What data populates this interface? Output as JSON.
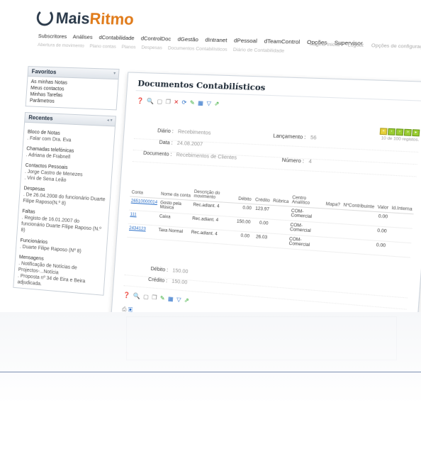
{
  "app": {
    "logo": {
      "prefix": "Mais",
      "accent": "Ritmo"
    },
    "nav": [
      "Subscritores",
      "Análises",
      "dContabilidade",
      "dControlDoc",
      "dGestão",
      "dIntranet",
      "dPessoal",
      "dTeamControl",
      "Opções",
      "Supervisor"
    ],
    "subnav": [
      "Abertura de movimento",
      "Plano contas",
      "Planos",
      "Despesas",
      "Documentos Contabilísticos",
      "Diário de Contabilidade"
    ],
    "top_links": [
      "Página Inicial",
      "Logout",
      "Opções de configuração"
    ]
  },
  "sidebar": {
    "favoritos": {
      "title": "Favoritos",
      "items": [
        "As minhas Notas",
        "Meus contactos",
        "Minhas Tarefas",
        "Parâmetros"
      ]
    },
    "recentes": {
      "title": "Recentes",
      "groups": [
        {
          "title": "Bloco de Notas",
          "items": [
            ". Falar com Dra. Eva"
          ]
        },
        {
          "title": "Chamadas telefónicas",
          "items": [
            ". Adriana de Frabnell"
          ]
        },
        {
          "title": "Contactos Pessoais",
          "items": [
            ". Jorge Castro de Menezes",
            ". Vini de Sena Leão"
          ]
        },
        {
          "title": "Despesas",
          "items": [
            ". De 26.04.2008 do funcionário Duarte Filipe Raposo(N.º 8)"
          ]
        },
        {
          "title": "Faltas",
          "items": [
            ". Registo de 16.01.2007 do funcionário Duarte Filipe Raposo (N.º 8)"
          ]
        },
        {
          "title": "Funcionários",
          "items": [
            ". Duarte Filipe Raposo (Nº 8)"
          ]
        },
        {
          "title": "Mensagens",
          "items": [
            ". Notificação de Notícias de Projectos-...Notícia",
            ". Proposta nº 34 de Eira e Beira adjudicada."
          ]
        }
      ]
    }
  },
  "main": {
    "title": "Documentos Contabilísticos",
    "pager_count": "10 de 100 registos.",
    "form": {
      "diario_label": "Diário :",
      "diario_value": "Recebimentos",
      "data_label": "Data :",
      "data_value": "24.08.2007",
      "documento_label": "Documento :",
      "documento_value": "Recebimentos de Clientes",
      "lancamento_label": "Lançamento :",
      "lancamento_value": "56",
      "numero_label": "Número :",
      "numero_value": "4"
    },
    "table": {
      "headers": [
        "Conta",
        "Nome da conta",
        "Descrição do movimento",
        "Débito",
        "Crédito",
        "Rúbrica",
        "Centro Analítico",
        "Mapa?",
        "NºContribuinte",
        "Valor",
        "Id.Interna"
      ],
      "rows": [
        [
          "26510000014",
          "Gosto pela Música",
          "Rec.adiant. 4",
          "0.00",
          "123.97",
          "",
          "COM- Comercial",
          "",
          "",
          "0.00",
          ""
        ],
        [
          "111",
          "Caixa",
          "Rec.adiant. 4",
          "150.00",
          "0.00",
          "",
          "COM- Comercial",
          "",
          "",
          "0.00",
          ""
        ],
        [
          "2434123",
          "Taxa Normal",
          "Rec.adiant. 4",
          "0.00",
          "26.03",
          "",
          "COM- Comercial",
          "",
          "",
          "0.00",
          ""
        ]
      ]
    },
    "totals": {
      "debito_label": "Débito :",
      "debito_value": "150.00",
      "credito_label": "Crédito :",
      "credito_value": "150.00"
    }
  },
  "icons": {
    "toolbar": [
      "help-icon",
      "search-icon",
      "new-icon",
      "copy-icon",
      "delete-icon",
      "refresh-icon",
      "edit-icon",
      "list-icon",
      "filter-icon",
      "export-icon"
    ],
    "pager": [
      "first-page-icon",
      "prev-page-icon",
      "next-page-icon",
      "last-page-icon",
      "go-icon"
    ]
  },
  "colors": {
    "accent": "#e07b1a",
    "link": "#2a6fc8",
    "pager_green": "#9acd32"
  }
}
